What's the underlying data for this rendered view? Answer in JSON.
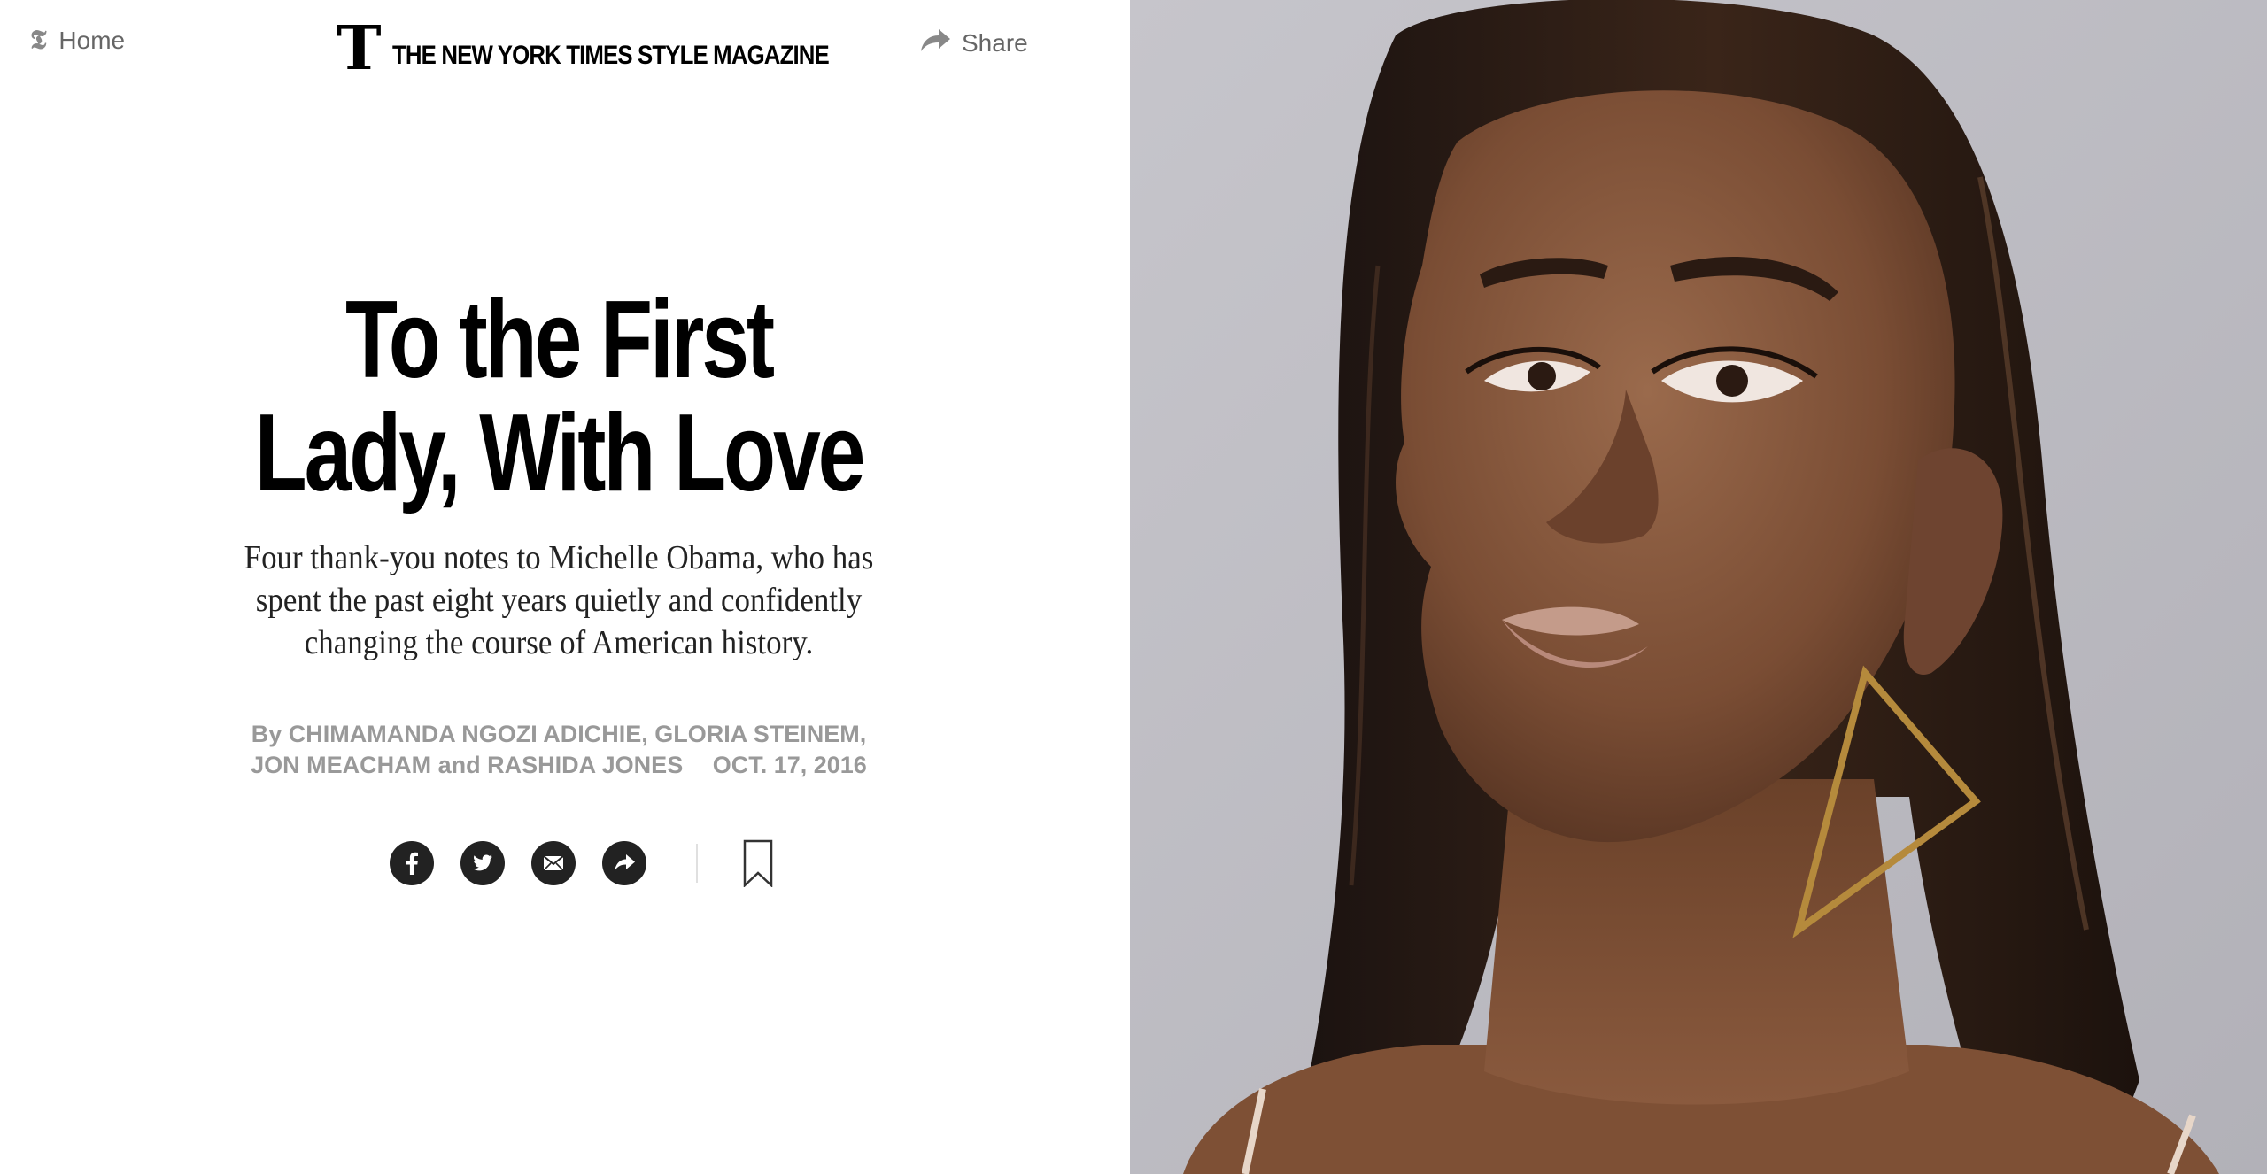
{
  "topbar": {
    "home_label": "Home",
    "masthead_letter": "T",
    "masthead_name": "THE NEW YORK TIMES STYLE MAGAZINE",
    "share_label": "Share"
  },
  "article": {
    "headline_line1": "To the First",
    "headline_line2": "Lady, With Love",
    "dek": "Four thank-you notes to Michelle Obama, who has spent the past eight years quietly and confidently changing the course of American history.",
    "byline_prefix": "By",
    "byline_authors_line1": "CHIMAMANDA NGOZI ADICHIE, GLORIA STEINEM,",
    "byline_authors_line2": "JON MEACHAM and RASHIDA JONES",
    "date": "OCT. 17, 2016"
  },
  "social": {
    "buttons": [
      {
        "icon": "facebook-icon"
      },
      {
        "icon": "twitter-icon"
      },
      {
        "icon": "email-icon"
      },
      {
        "icon": "share-arrow-icon"
      }
    ],
    "bookmark_icon": "bookmark-icon"
  },
  "colors": {
    "headline": "#000000",
    "byline": "#999999",
    "icon_circle": "#222222",
    "nav_text": "#666666"
  },
  "photo": {
    "icon": "portrait-photo"
  }
}
